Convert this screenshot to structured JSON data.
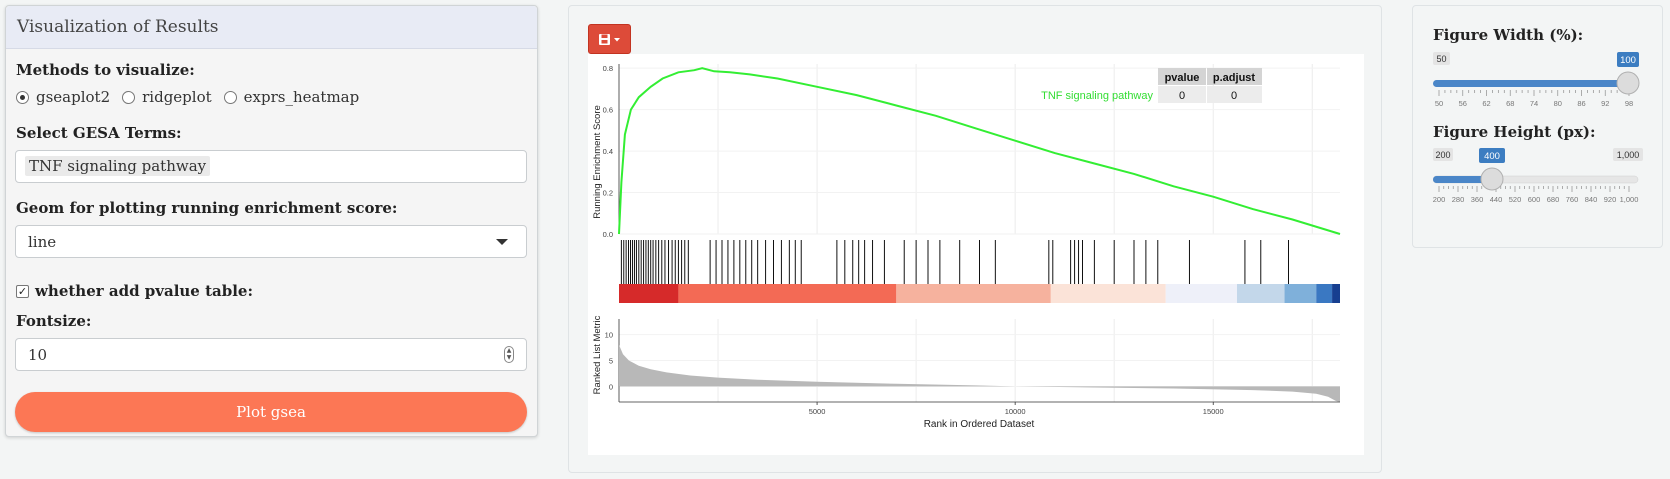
{
  "left_panel": {
    "title": "Visualization of Results",
    "methods_label": "Methods to visualize:",
    "methods": [
      {
        "label": "gseaplot2",
        "checked": true
      },
      {
        "label": "ridgeplot",
        "checked": false
      },
      {
        "label": "exprs_heatmap",
        "checked": false
      }
    ],
    "terms_label": "Select GESA Terms:",
    "terms_selected": "TNF signaling pathway",
    "geom_label": "Geom for plotting running enrichment score:",
    "geom_value": "line",
    "pvalue_label": "whether add pvalue table:",
    "pvalue_checked": true,
    "fontsize_label": "Fontsize:",
    "fontsize_value": "10",
    "plot_button": "Plot gsea"
  },
  "plot": {
    "save_icon": "floppy-disk-icon",
    "table_headers": [
      "pvalue",
      "p.adjust"
    ],
    "table_row_label": "TNF signaling pathway",
    "table_row_values": [
      "0",
      "0"
    ]
  },
  "chart_data": {
    "type": "line",
    "ylabel_top": "Running Enrichment Score",
    "ylabel_bottom": "Ranked List Metric",
    "xlabel": "Rank in Ordered Dataset",
    "x_ticks": [
      5000,
      10000,
      15000
    ],
    "x_tick_labels": [
      "5000",
      "10000",
      "15000"
    ],
    "xlim": [
      0,
      18200
    ],
    "es_yticks": [
      "0.8",
      "0.6",
      "0.4",
      "0.2",
      "0.0"
    ],
    "es_ylim": [
      0,
      0.82
    ],
    "metric_yticks": [
      "10",
      "5",
      "0"
    ],
    "metric_ylim": [
      -3,
      13
    ],
    "series": [
      {
        "color": "#33ee33",
        "x": [
          0,
          60,
          150,
          300,
          500,
          800,
          1100,
          1500,
          1900,
          2100,
          2400,
          2800,
          3300,
          4000,
          5000,
          6000,
          7000,
          8000,
          9000,
          10000,
          11000,
          12000,
          13000,
          14000,
          15000,
          16000,
          17000,
          18200
        ],
        "y": [
          0.0,
          0.25,
          0.48,
          0.6,
          0.66,
          0.71,
          0.75,
          0.78,
          0.79,
          0.8,
          0.785,
          0.78,
          0.77,
          0.75,
          0.71,
          0.67,
          0.62,
          0.57,
          0.51,
          0.45,
          0.39,
          0.34,
          0.29,
          0.23,
          0.18,
          0.12,
          0.07,
          0.0
        ]
      }
    ],
    "hit_positions": [
      60,
      120,
      180,
      240,
      290,
      340,
      390,
      440,
      500,
      560,
      620,
      680,
      740,
      800,
      860,
      930,
      1000,
      1080,
      1160,
      1250,
      1340,
      1420,
      1500,
      1580,
      1660,
      1750,
      2300,
      2450,
      2600,
      2750,
      2900,
      3050,
      3200,
      3350,
      3500,
      3700,
      3900,
      4100,
      4300,
      4450,
      4600,
      5500,
      5700,
      5900,
      6050,
      6200,
      6400,
      6700,
      7200,
      7500,
      7800,
      8100,
      8600,
      9100,
      9500,
      10850,
      10950,
      11400,
      11500,
      11600,
      11700,
      12000,
      12500,
      13000,
      13300,
      13600,
      14400,
      15800,
      16200,
      16900
    ],
    "heat_bands": [
      {
        "from": 0,
        "to": 1500,
        "color": "#d62a2a"
      },
      {
        "from": 1500,
        "to": 7000,
        "color": "#f36a55"
      },
      {
        "from": 7000,
        "to": 10900,
        "color": "#f6b29e"
      },
      {
        "from": 10900,
        "to": 13800,
        "color": "#fbe3d8"
      },
      {
        "from": 13800,
        "to": 15600,
        "color": "#eef0f9"
      },
      {
        "from": 15600,
        "to": 16800,
        "color": "#c3d7ea"
      },
      {
        "from": 16800,
        "to": 17600,
        "color": "#7fb0da"
      },
      {
        "from": 17600,
        "to": 18000,
        "color": "#3a78c2"
      },
      {
        "from": 18000,
        "to": 18200,
        "color": "#173f90"
      }
    ],
    "ranked_metric": {
      "x": [
        0,
        100,
        250,
        500,
        800,
        1200,
        1800,
        2500,
        3500,
        5000,
        7000,
        9000,
        10000,
        12000,
        14000,
        16000,
        17000,
        17600,
        17900,
        18100,
        18200
      ],
      "y": [
        8,
        6.2,
        5.0,
        4.0,
        3.3,
        2.7,
        2.1,
        1.7,
        1.3,
        0.9,
        0.5,
        0.2,
        0.0,
        -0.2,
        -0.4,
        -0.7,
        -1.0,
        -1.4,
        -2.0,
        -2.8,
        -3.0
      ]
    }
  },
  "right_panel": {
    "width_label": "Figure Width (%):",
    "width_min": "50",
    "width_value": "100",
    "width_ticks": [
      "50",
      "56",
      "62",
      "68",
      "74",
      "80",
      "86",
      "92",
      "98"
    ],
    "width_fraction": 1.0,
    "height_label": "Figure Height (px):",
    "height_min": "200",
    "height_value": "400",
    "height_max": "1,000",
    "height_ticks": [
      "200",
      "280",
      "360",
      "440",
      "520",
      "600",
      "680",
      "760",
      "840",
      "920",
      "1,000"
    ],
    "height_fraction": 0.25
  }
}
